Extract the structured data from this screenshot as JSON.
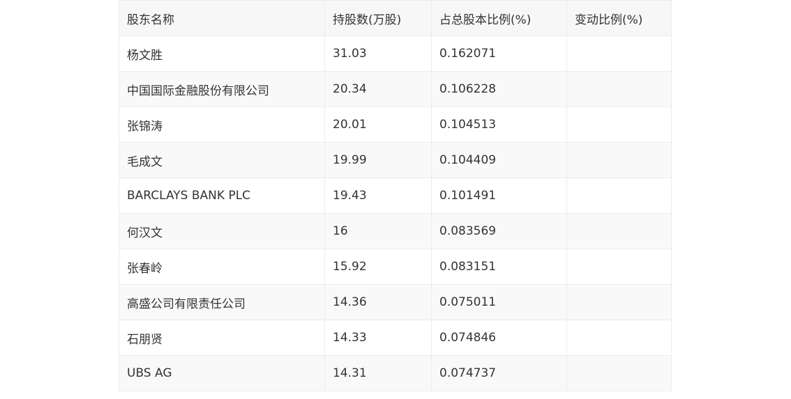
{
  "table": {
    "headers": [
      "股东名称",
      "持股数(万股)",
      "占总股本比例(%)",
      "变动比例(%)"
    ],
    "rows": [
      [
        "杨文胜",
        "31.03",
        "0.162071",
        ""
      ],
      [
        "中国国际金融股份有限公司",
        "20.34",
        "0.106228",
        ""
      ],
      [
        "张锦涛",
        "20.01",
        "0.104513",
        ""
      ],
      [
        "毛成文",
        "19.99",
        "0.104409",
        ""
      ],
      [
        "BARCLAYS BANK PLC",
        "19.43",
        "0.101491",
        ""
      ],
      [
        "何汉文",
        "16",
        "0.083569",
        ""
      ],
      [
        "张春岭",
        "15.92",
        "0.083151",
        ""
      ],
      [
        "高盛公司有限责任公司",
        "14.36",
        "0.075011",
        ""
      ],
      [
        "石朋贤",
        "14.33",
        "0.074846",
        ""
      ],
      [
        "UBS AG",
        "14.31",
        "0.074737",
        ""
      ]
    ]
  }
}
